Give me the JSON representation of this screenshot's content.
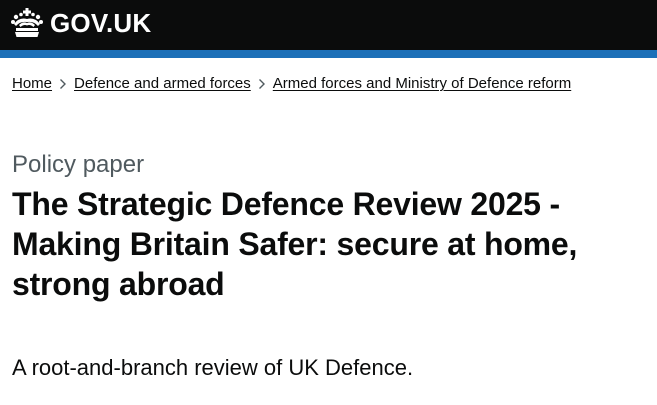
{
  "header": {
    "logo_text": "GOV.UK",
    "logo_icon": "crown-icon",
    "background_color": "#0b0c0c",
    "stripe_color": "#1d70b8"
  },
  "breadcrumb": {
    "items": [
      {
        "label": "Home"
      },
      {
        "label": "Defence and armed forces"
      },
      {
        "label": "Armed forces and Ministry of Defence reform"
      }
    ],
    "separator_icon": "chevron-right-icon"
  },
  "main": {
    "caption": "Policy paper",
    "title": "The Strategic Defence Review 2025 - Making Britain Safer: secure at home, strong abroad",
    "lead": "A root-and-branch review of UK Defence."
  }
}
